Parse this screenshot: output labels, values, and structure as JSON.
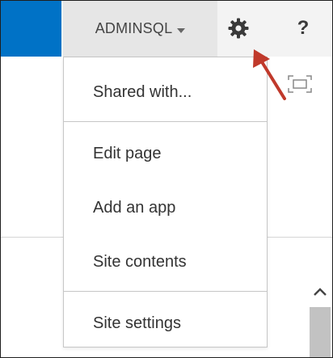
{
  "header": {
    "user_label": "ADMINSQL",
    "help_label": "?",
    "brand_color": "#0072c6",
    "gear_icon": "gear-icon",
    "focus_icon": "focus-on-content-icon"
  },
  "menu": {
    "items": [
      {
        "label": "Shared with..."
      },
      {
        "label": "Edit page"
      },
      {
        "label": "Add an app"
      },
      {
        "label": "Site contents"
      },
      {
        "label": "Site settings"
      }
    ]
  },
  "annotation": {
    "arrow_color": "#c0392b",
    "points_to": "gear-icon"
  }
}
